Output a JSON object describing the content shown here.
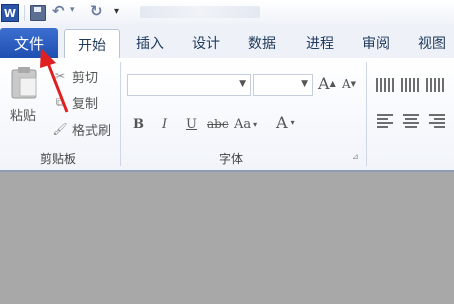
{
  "quick_access": {
    "app_icon_text": "W",
    "save_icon": "save-icon",
    "undo_icon": "undo-icon",
    "redo_icon": "redo-icon"
  },
  "tabs": {
    "file": "文件",
    "items": [
      "开始",
      "插入",
      "设计",
      "数据",
      "进程",
      "审阅",
      "视图"
    ]
  },
  "clipboard": {
    "paste": "粘贴",
    "cut": "剪切",
    "copy": "复制",
    "format_painter": "格式刷",
    "group_label": "剪贴板"
  },
  "font": {
    "font_name_value": "",
    "font_size_value": "",
    "grow": "A",
    "shrink": "A",
    "bold": "B",
    "italic": "I",
    "underline": "U",
    "strikethrough": "abc",
    "change_case": "Aa",
    "font_color": "A",
    "group_label": "字体"
  },
  "colors": {
    "file_tab": "#2a5bbf",
    "annotation_arrow": "#e02020",
    "doc_background": "#a8a8a8"
  }
}
